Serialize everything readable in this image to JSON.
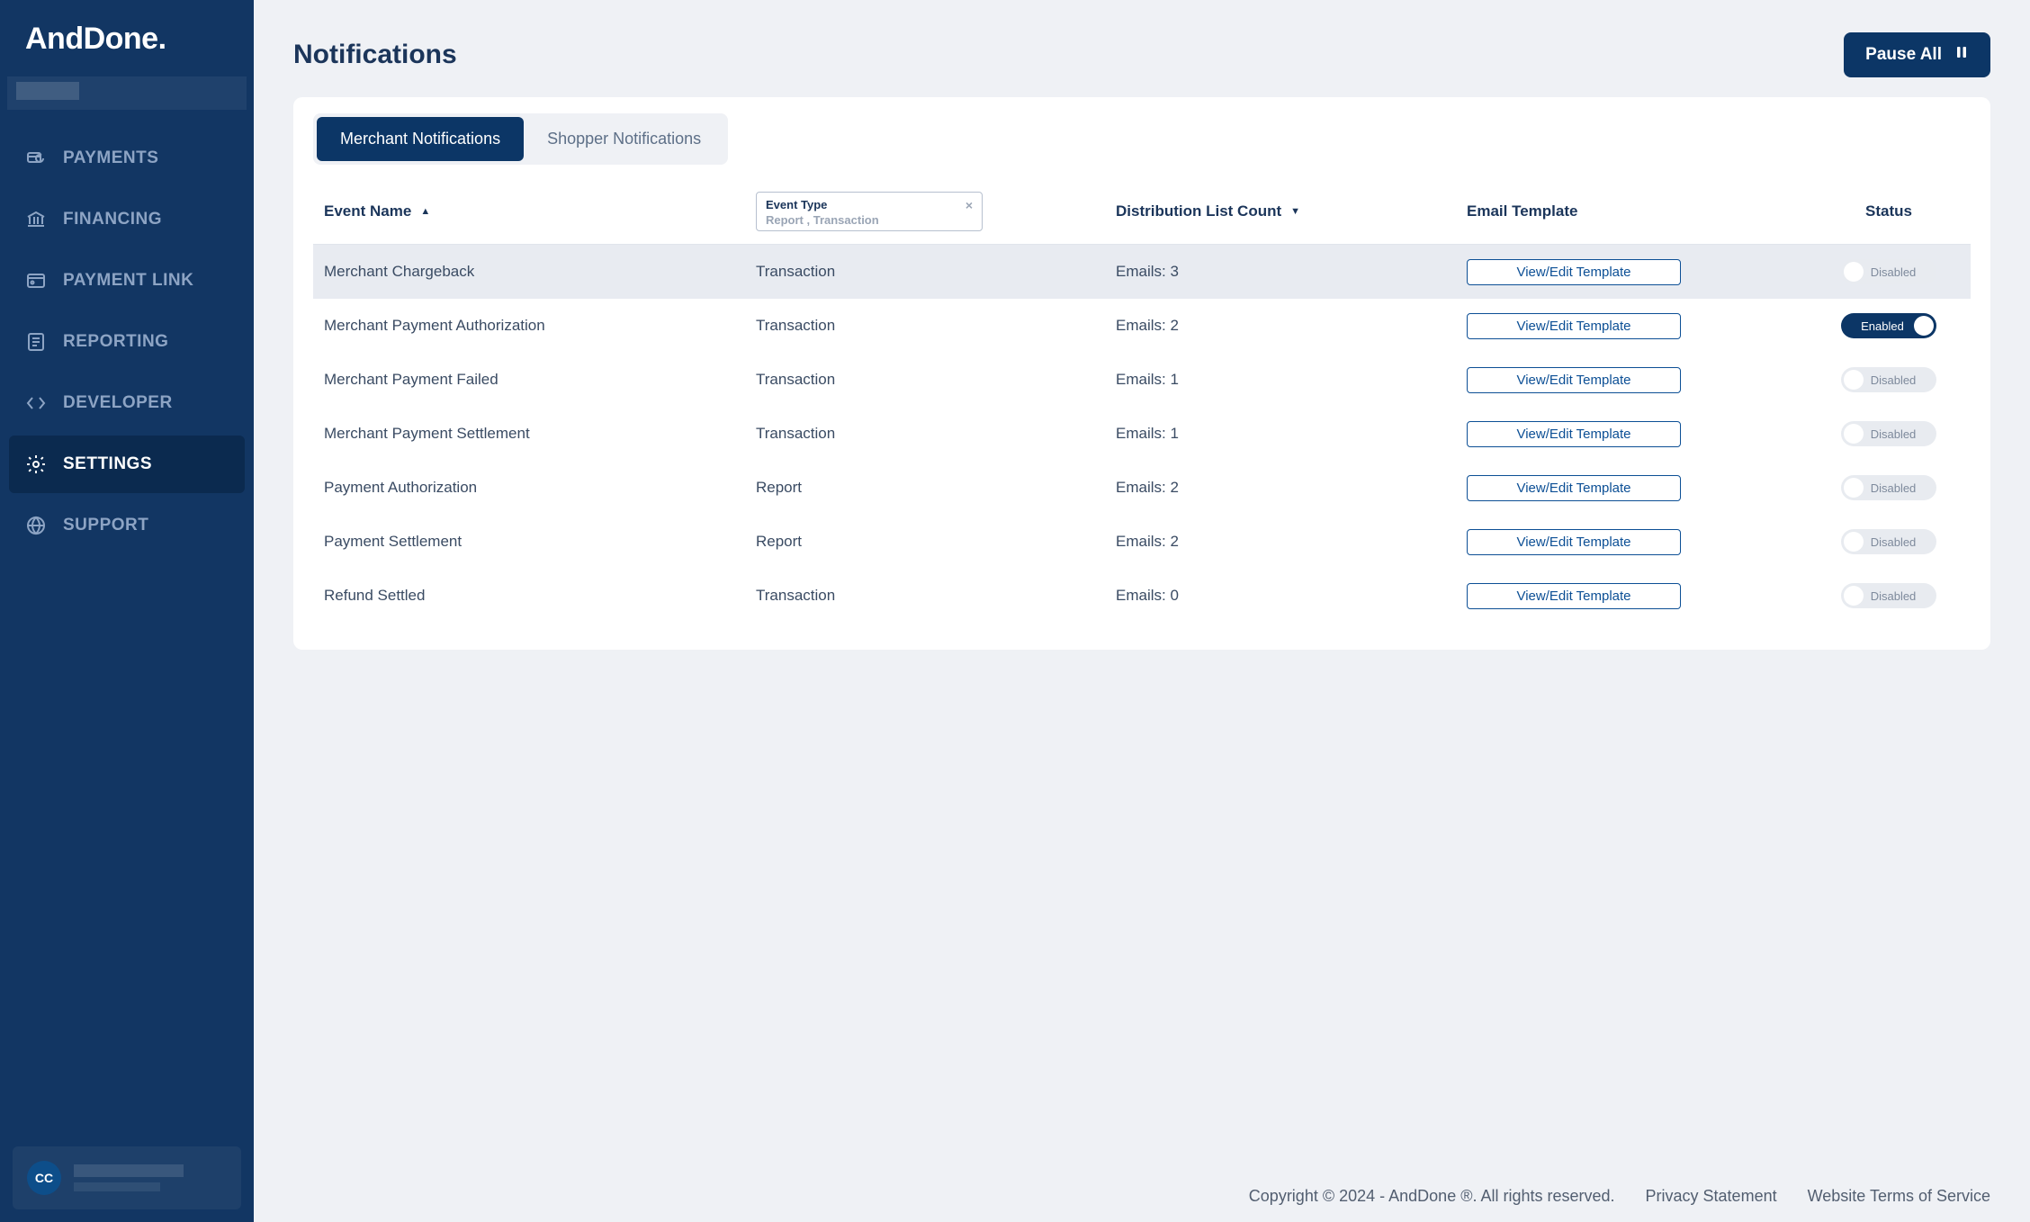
{
  "brand": "AndDone.",
  "sidebar": {
    "items": [
      {
        "label": "PAYMENTS",
        "icon": "card-sync-icon"
      },
      {
        "label": "FINANCING",
        "icon": "bank-icon"
      },
      {
        "label": "PAYMENT LINK",
        "icon": "link-card-icon"
      },
      {
        "label": "REPORTING",
        "icon": "report-icon"
      },
      {
        "label": "DEVELOPER",
        "icon": "code-icon"
      },
      {
        "label": "SETTINGS",
        "icon": "gear-icon"
      },
      {
        "label": "SUPPORT",
        "icon": "globe-icon"
      }
    ],
    "active_index": 5
  },
  "user": {
    "initials": "CC"
  },
  "header": {
    "title": "Notifications",
    "pause_label": "Pause All"
  },
  "tabs": [
    {
      "label": "Merchant Notifications",
      "active": true
    },
    {
      "label": "Shopper Notifications",
      "active": false
    }
  ],
  "columns": {
    "event_name": "Event Name",
    "event_type": "Event Type",
    "event_type_filter": "Report , Transaction",
    "dist_count": "Distribution List Count",
    "email_template": "Email Template",
    "status": "Status"
  },
  "template_button_label": "View/Edit Template",
  "status_labels": {
    "enabled": "Enabled",
    "disabled": "Disabled"
  },
  "rows": [
    {
      "name": "Merchant Chargeback",
      "type": "Transaction",
      "count": "Emails: 3",
      "enabled": false,
      "highlight": true
    },
    {
      "name": "Merchant Payment Authorization",
      "type": "Transaction",
      "count": "Emails: 2",
      "enabled": true,
      "highlight": false
    },
    {
      "name": "Merchant Payment Failed",
      "type": "Transaction",
      "count": "Emails: 1",
      "enabled": false,
      "highlight": false
    },
    {
      "name": "Merchant Payment Settlement",
      "type": "Transaction",
      "count": "Emails: 1",
      "enabled": false,
      "highlight": false
    },
    {
      "name": "Payment Authorization",
      "type": "Report",
      "count": "Emails: 2",
      "enabled": false,
      "highlight": false
    },
    {
      "name": "Payment Settlement",
      "type": "Report",
      "count": "Emails: 2",
      "enabled": false,
      "highlight": false
    },
    {
      "name": "Refund Settled",
      "type": "Transaction",
      "count": "Emails: 0",
      "enabled": false,
      "highlight": false
    }
  ],
  "footer": {
    "copyright": "Copyright © 2024 - AndDone ®. All rights reserved.",
    "privacy": "Privacy Statement",
    "terms": "Website Terms of Service"
  }
}
